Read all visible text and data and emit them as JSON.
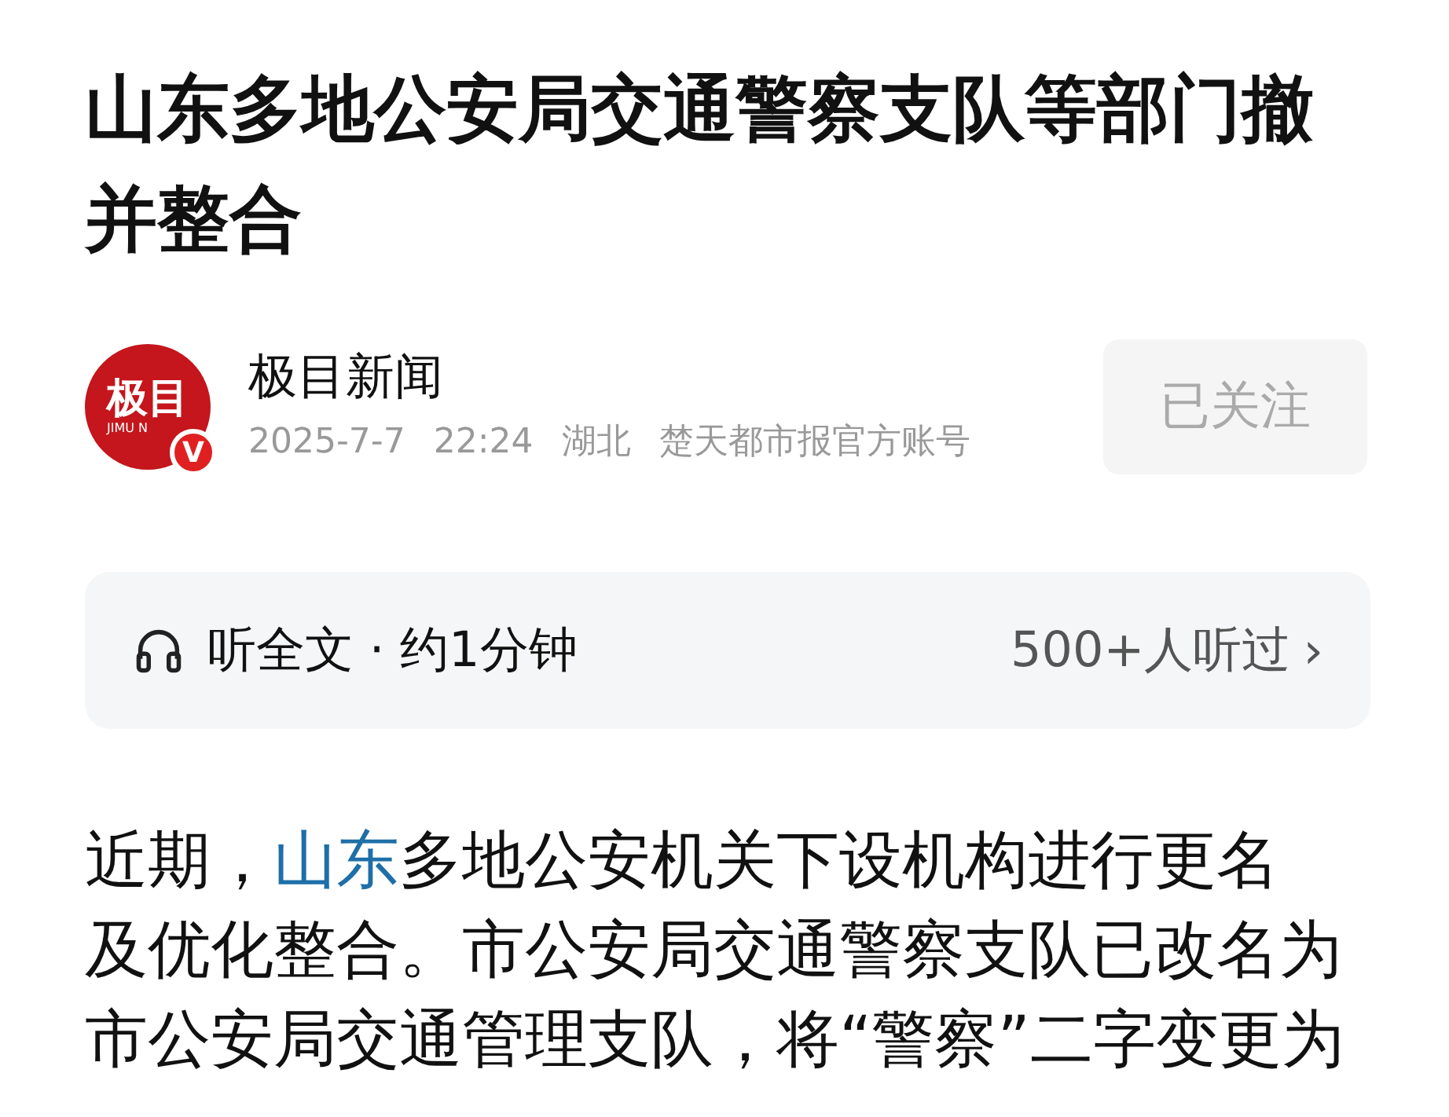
{
  "title": "山东多地公安局交通警察支队等部门撤并整合",
  "author": {
    "logo_text": "极目",
    "logo_subtext": "JIMU N",
    "badge": "V",
    "name": "极目新闻",
    "date": "2025-7-7",
    "time": "22:24",
    "region": "湖北",
    "account": "楚天都市报官方账号",
    "follow_label": "已关注",
    "followed": true
  },
  "audio": {
    "label": "听全文 · 约1分钟",
    "listeners": "500+人听过",
    "chevron": "›"
  },
  "paragraph": [
    {
      "kind": "text",
      "text": "近期，"
    },
    {
      "kind": "link",
      "text": "山东"
    },
    {
      "kind": "text",
      "text": "多地公安机关下设机构进行更名"
    },
    {
      "kind": "break"
    },
    {
      "kind": "text",
      "text": "及优化整合。市公安局交通警察支队已改名为市公安局交通管理支队，将“警察”二字变更为"
    }
  ]
}
